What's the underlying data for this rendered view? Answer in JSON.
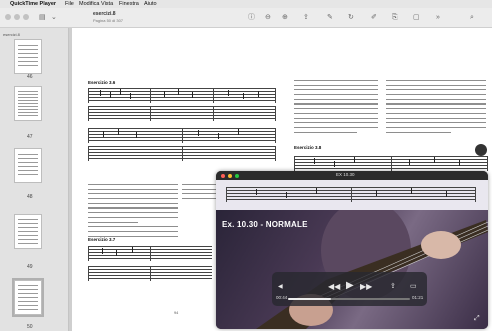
{
  "menubar": {
    "apple": "",
    "app": "QuickTime Player",
    "items": [
      "File",
      "Modifica",
      "Vista",
      "Finestra",
      "Aiuto"
    ]
  },
  "document": {
    "title": "esercizi.8",
    "subtitle": "Pagina 50 di 307"
  },
  "sidebar": {
    "label": "esercizi.8",
    "page_numbers": [
      "46",
      "47",
      "48",
      "49",
      "50"
    ],
    "selected_page": "50"
  },
  "page": {
    "exercise_left_top": "Esercizio 3.6",
    "exercise_right_top": "Esercizio 3.8",
    "exercise_left_bottom": "Esercizio 3.7",
    "page_number": "94"
  },
  "video": {
    "window_title": "EX 10.30",
    "overlay_label": "Ex. 10.30 - NORMALE",
    "time_elapsed": "00:44",
    "time_remaining": "01:21",
    "progress": 0.35,
    "colors": {
      "close": "#ff5f57",
      "minimize": "#febc2e",
      "zoom": "#28c840"
    }
  }
}
